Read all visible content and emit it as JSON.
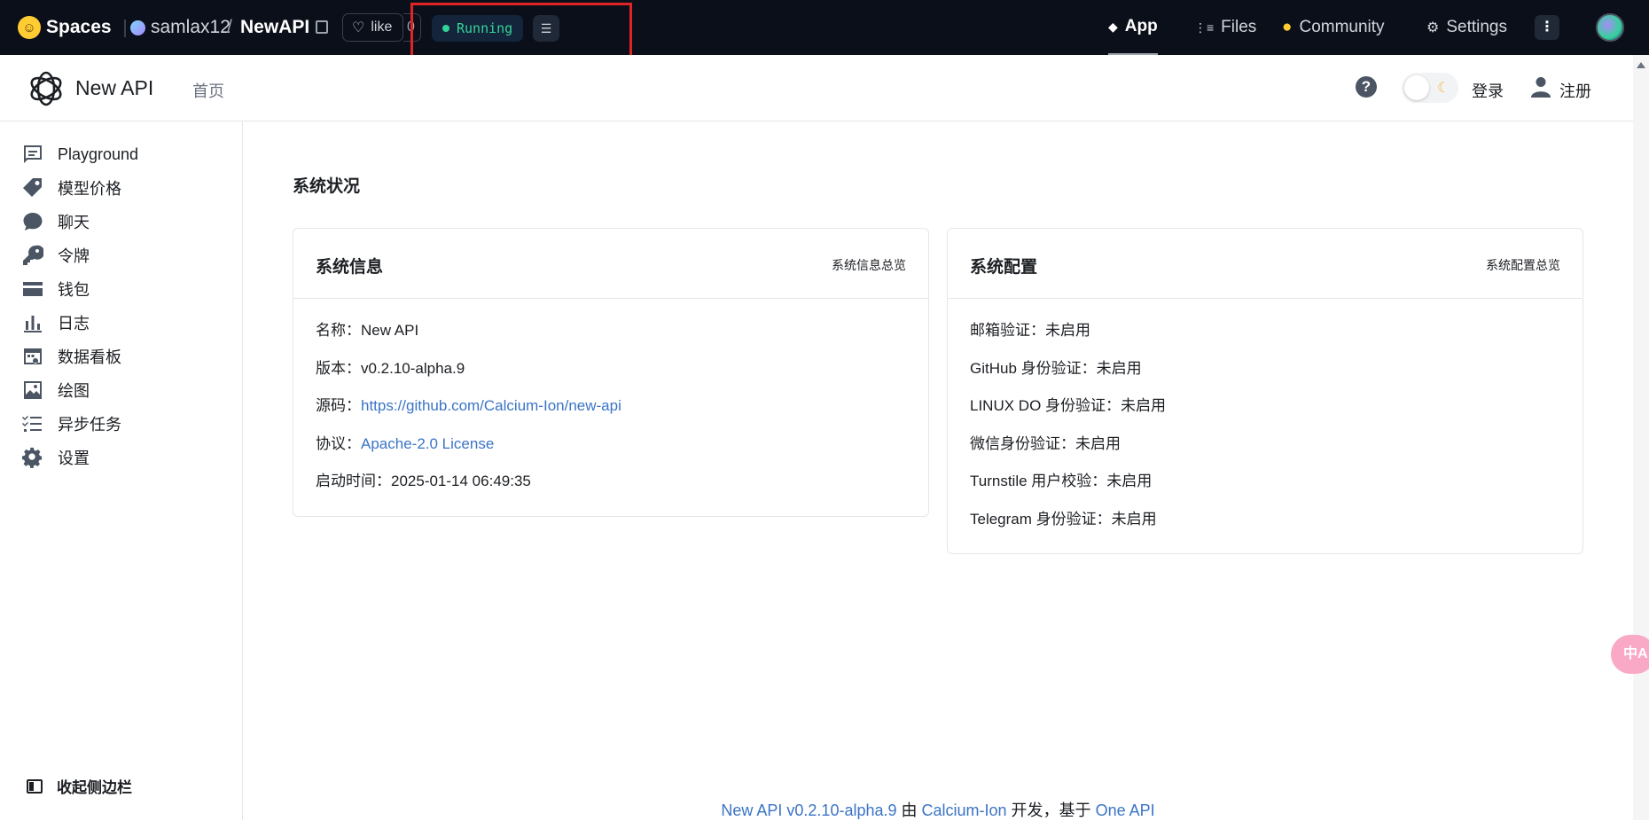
{
  "hf_bar": {
    "logo": "hugging-face-icon",
    "spaces_label": "Spaces",
    "owner": "samlax12",
    "slash": "/",
    "repo": "NewAPI",
    "like_label": "like",
    "like_count": "0",
    "status": "Running",
    "nav": [
      {
        "label": "App",
        "icon": "cube-icon"
      },
      {
        "label": "Files",
        "icon": "files-icon"
      },
      {
        "label": "Community",
        "icon": "community-icon"
      },
      {
        "label": "Settings",
        "icon": "gear-icon"
      }
    ],
    "more": "⋮"
  },
  "header": {
    "title": "New API",
    "home": "首页",
    "help": "?",
    "login": "登录",
    "register": "注册"
  },
  "sidebar": {
    "items": [
      {
        "label": "Playground",
        "icon": "message-icon"
      },
      {
        "label": "模型价格",
        "icon": "tag-icon"
      },
      {
        "label": "聊天",
        "icon": "chat-icon"
      },
      {
        "label": "令牌",
        "icon": "key-icon"
      },
      {
        "label": "钱包",
        "icon": "wallet-icon"
      },
      {
        "label": "日志",
        "icon": "bar-chart-icon"
      },
      {
        "label": "数据看板",
        "icon": "calendar-icon"
      },
      {
        "label": "绘图",
        "icon": "image-icon"
      },
      {
        "label": "异步任务",
        "icon": "task-list-icon"
      },
      {
        "label": "设置",
        "icon": "gear-icon"
      }
    ],
    "collapse": "收起侧边栏"
  },
  "main": {
    "section_title": "系统状况",
    "info_card": {
      "title": "系统信息",
      "extra": "系统信息总览",
      "rows": [
        {
          "label": "名称：",
          "value": "New API",
          "link": false
        },
        {
          "label": "版本：",
          "value": "v0.2.10-alpha.9",
          "link": false
        },
        {
          "label": "源码：",
          "value": "https://github.com/Calcium-Ion/new-api",
          "link": true
        },
        {
          "label": "协议：",
          "value": "Apache-2.0 License",
          "link": true
        },
        {
          "label": "启动时间：",
          "value": "2025-01-14 06:49:35",
          "link": false
        }
      ]
    },
    "config_card": {
      "title": "系统配置",
      "extra": "系统配置总览",
      "rows": [
        {
          "label": "邮箱验证：",
          "value": "未启用"
        },
        {
          "label": "GitHub 身份验证：",
          "value": "未启用"
        },
        {
          "label": "LINUX DO 身份验证：",
          "value": "未启用"
        },
        {
          "label": "微信身份验证：",
          "value": "未启用"
        },
        {
          "label": "Turnstile 用户校验：",
          "value": "未启用"
        },
        {
          "label": "Telegram 身份验证：",
          "value": "未启用"
        }
      ]
    }
  },
  "footer": {
    "product": "New API v0.2.10-alpha.9",
    "by": " 由 ",
    "author": "Calcium-Ion",
    "dev": " 开发，基于 ",
    "base": "One API"
  },
  "colors": {
    "link": "#3b74c6",
    "running": "#34d399",
    "highlight": "#e02424"
  },
  "translate_fab": "中A"
}
